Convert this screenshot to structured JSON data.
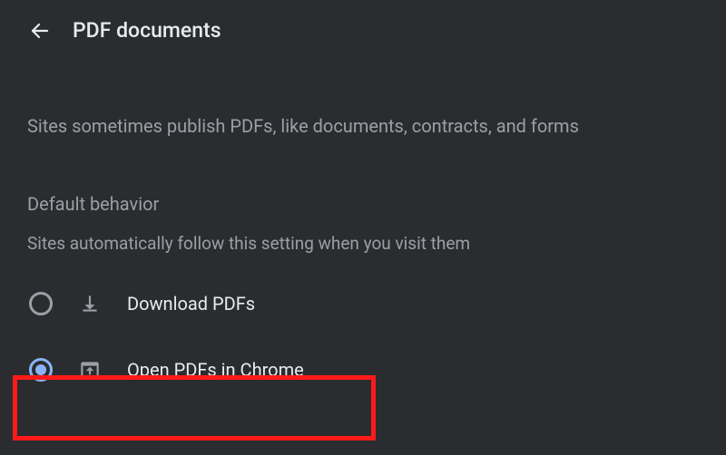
{
  "header": {
    "title": "PDF documents"
  },
  "description": "Sites sometimes publish PDFs, like documents, contracts, and forms",
  "section": {
    "heading": "Default behavior",
    "subtext": "Sites automatically follow this setting when you visit them"
  },
  "options": {
    "download": {
      "label": "Download PDFs",
      "selected": false
    },
    "open": {
      "label": "Open PDFs in Chrome",
      "selected": true
    }
  }
}
